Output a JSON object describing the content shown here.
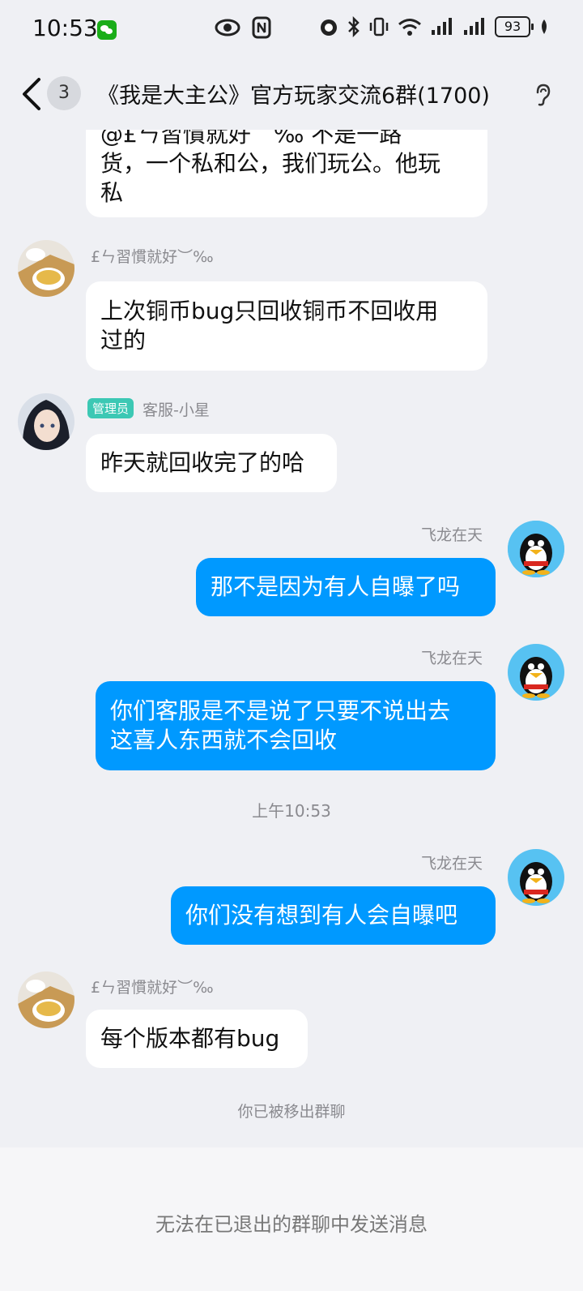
{
  "status_bar": {
    "time": "10:53",
    "battery": "93",
    "icons": [
      "wechat-icon",
      "eye-icon",
      "nfc-icon",
      "alarm-icon",
      "bluetooth-icon",
      "vibrate-icon",
      "wifi-icon",
      "signal-icon",
      "signal-icon",
      "battery-icon",
      "leaf-icon"
    ]
  },
  "header": {
    "back_count": "3",
    "title": "《我是大主公》官方玩家交流6群(1700)"
  },
  "messages": [
    {
      "type": "in-partial",
      "text_lines": [
        "@£ㄣ習慣就好︶‰ 不是一路",
        "货，一个私和公，我们玩公。他玩",
        "私"
      ]
    },
    {
      "type": "in",
      "nick": "£ㄣ習慣就好︶‰",
      "text_lines": [
        "上次铜币bug只回收铜币不回收用",
        "过的"
      ]
    },
    {
      "type": "in",
      "nick": "客服-小星",
      "role": "管理员",
      "text_lines": [
        "昨天就回收完了的哈"
      ]
    },
    {
      "type": "out",
      "nick": "飞龙在天",
      "text_lines": [
        "那不是因为有人自曝了吗"
      ]
    },
    {
      "type": "out",
      "nick": "飞龙在天",
      "text_lines": [
        "你们客服是不是说了只要不说出去",
        "这喜人东西就不会回收"
      ]
    },
    {
      "type": "time",
      "text": "上午10:53"
    },
    {
      "type": "out",
      "nick": "飞龙在天",
      "text_lines": [
        "你们没有想到有人会自曝吧"
      ]
    },
    {
      "type": "in",
      "nick": "£ㄣ習慣就好︶‰",
      "text_lines": [
        "每个版本都有bug"
      ]
    },
    {
      "type": "system",
      "text": "你已被移出群聊"
    }
  ],
  "bottom": {
    "notice": "无法在已退出的群聊中发送消息"
  },
  "colors": {
    "background": "#eff0f4",
    "outgoing_bubble": "#0099ff",
    "incoming_bubble": "#ffffff",
    "admin_tag": "#3cc8b4"
  }
}
